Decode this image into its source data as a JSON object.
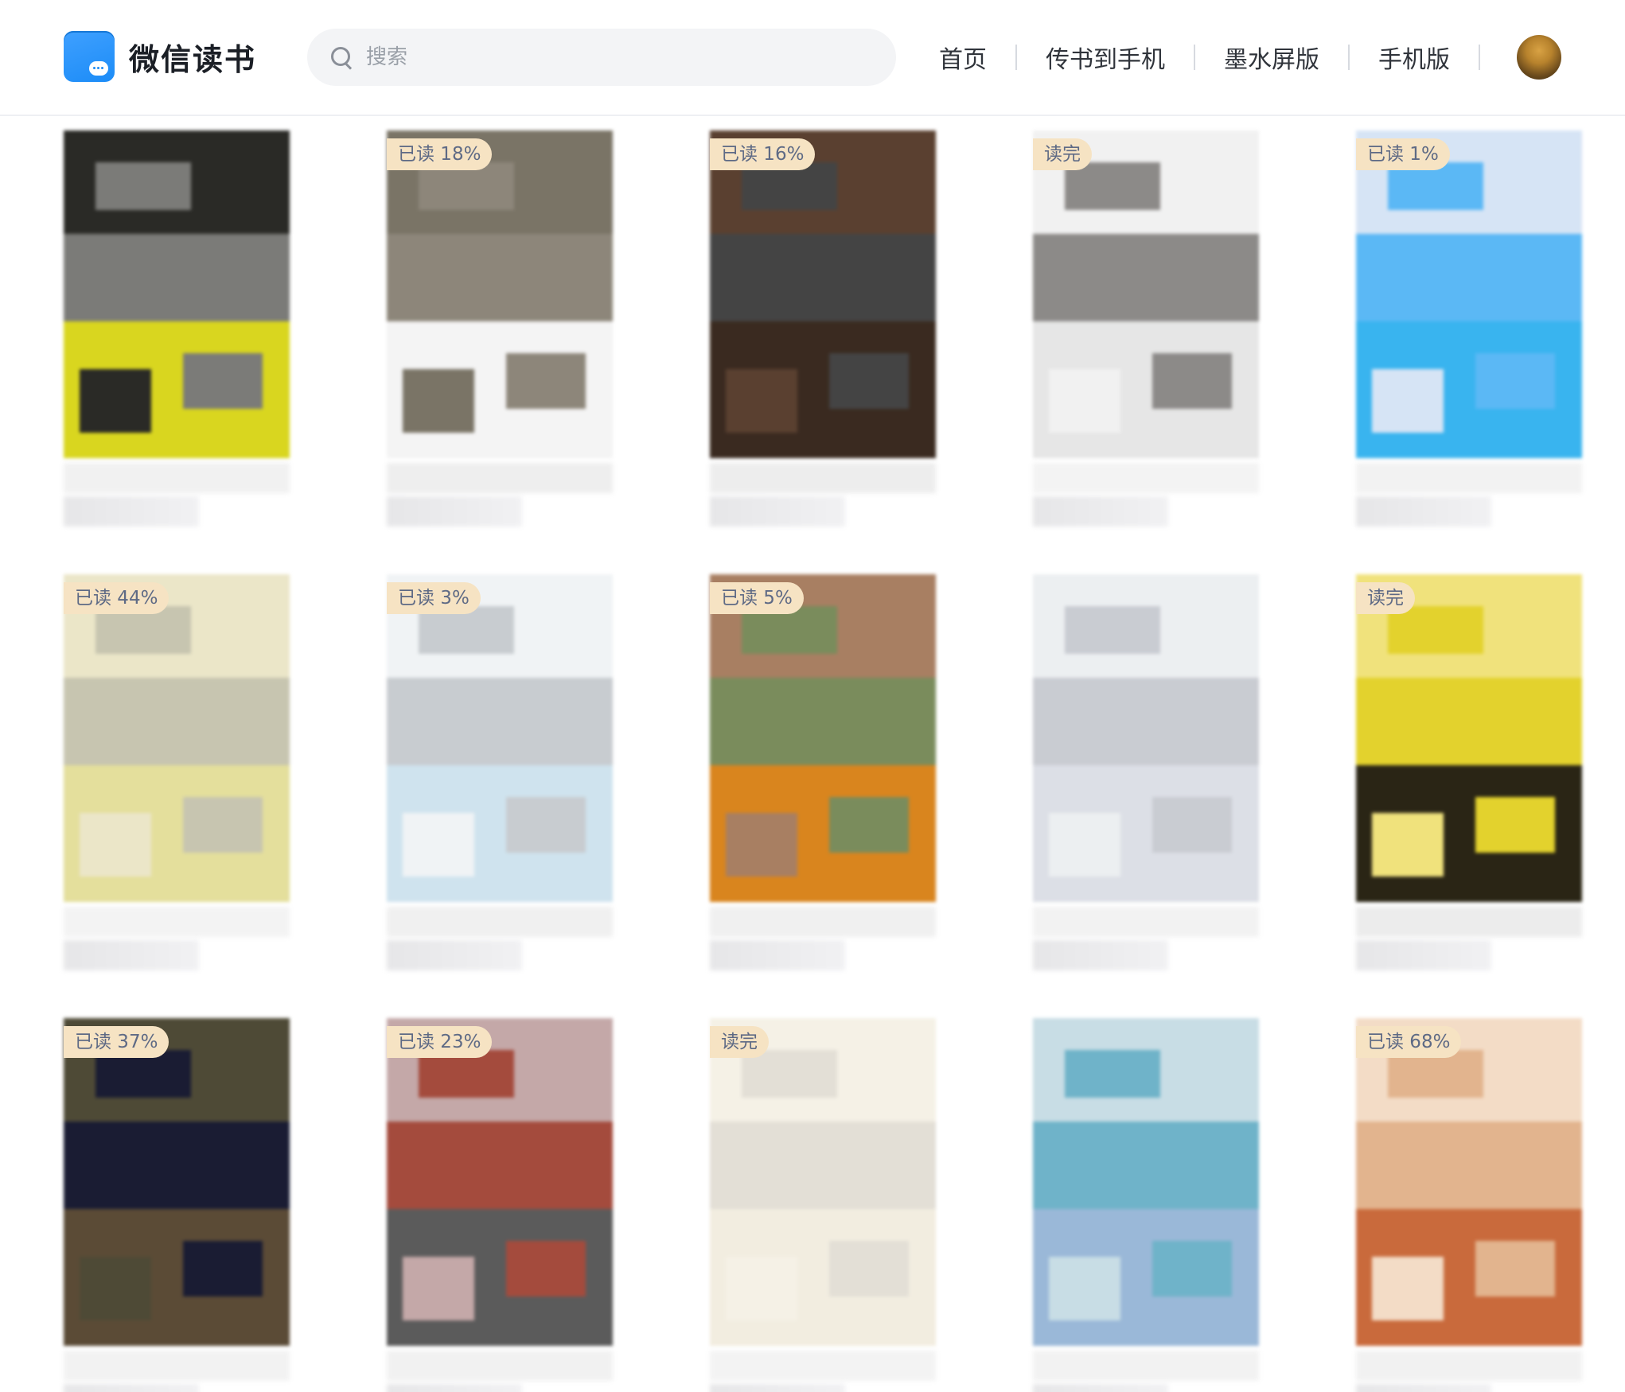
{
  "app": {
    "title": "微信读书"
  },
  "search": {
    "placeholder": "搜索"
  },
  "nav": {
    "items": [
      "首页",
      "传书到手机",
      "墨水屏版",
      "手机版"
    ]
  },
  "icons": {
    "logo": "weread-logo-icon",
    "search": "search-icon",
    "avatar": "user-avatar"
  },
  "colors": {
    "brand": "#1c8cf7",
    "badge_bg": "#f6e3c3",
    "badge_text": "#5e6a85"
  },
  "books": [
    {
      "badge": "",
      "colors": [
        "#2a2a26",
        "#7b7b78",
        "#d9d61f",
        "#f1f1f1"
      ]
    },
    {
      "badge": "已读 18%",
      "colors": [
        "#7a7466",
        "#8d867a",
        "#f4f4f4",
        "#eeeeee"
      ]
    },
    {
      "badge": "已读 16%",
      "colors": [
        "#5a4030",
        "#444",
        "#3a2a20",
        "#ededed"
      ]
    },
    {
      "badge": "读完",
      "colors": [
        "#f1f1f1",
        "#8c8a88",
        "#e6e6e6",
        "#f3f3f3"
      ]
    },
    {
      "badge": "已读 1%",
      "colors": [
        "#d6e4f5",
        "#5bb8f5",
        "#39b4ef",
        "#f2f2f2"
      ]
    },
    {
      "badge": "已读 44%",
      "colors": [
        "#ebe6c8",
        "#c7c5b0",
        "#e4df9c",
        "#f3f3f3"
      ]
    },
    {
      "badge": "已读 3%",
      "colors": [
        "#f0f3f5",
        "#c8ccd0",
        "#cfe3ee",
        "#f0f0f0"
      ]
    },
    {
      "badge": "已读 5%",
      "colors": [
        "#a87f62",
        "#7a8c5c",
        "#d9851e",
        "#f0f0f0"
      ]
    },
    {
      "badge": "",
      "colors": [
        "#eceff1",
        "#c9ccd2",
        "#dcdfe6",
        "#f2f2f2"
      ]
    },
    {
      "badge": "读完",
      "colors": [
        "#f0e27c",
        "#e3d22d",
        "#2a2515",
        "#ececec"
      ]
    },
    {
      "badge": "已读 37%",
      "colors": [
        "#4e4a36",
        "#1a1c33",
        "#5b4b36",
        "#f2f2f2"
      ]
    },
    {
      "badge": "已读 23%",
      "colors": [
        "#c4a8a8",
        "#a44b3d",
        "#5b5b5b",
        "#f1f1f1"
      ]
    },
    {
      "badge": "读完",
      "colors": [
        "#f5f1e6",
        "#e3dfd6",
        "#f2ede0",
        "#f3f3f3"
      ]
    },
    {
      "badge": "",
      "colors": [
        "#c8dde5",
        "#6fb3c9",
        "#9ab8d8",
        "#f2f2f2"
      ]
    },
    {
      "badge": "已读 68%",
      "colors": [
        "#f3dcc6",
        "#e2b48e",
        "#c96a3c",
        "#f1f1f1"
      ]
    }
  ]
}
